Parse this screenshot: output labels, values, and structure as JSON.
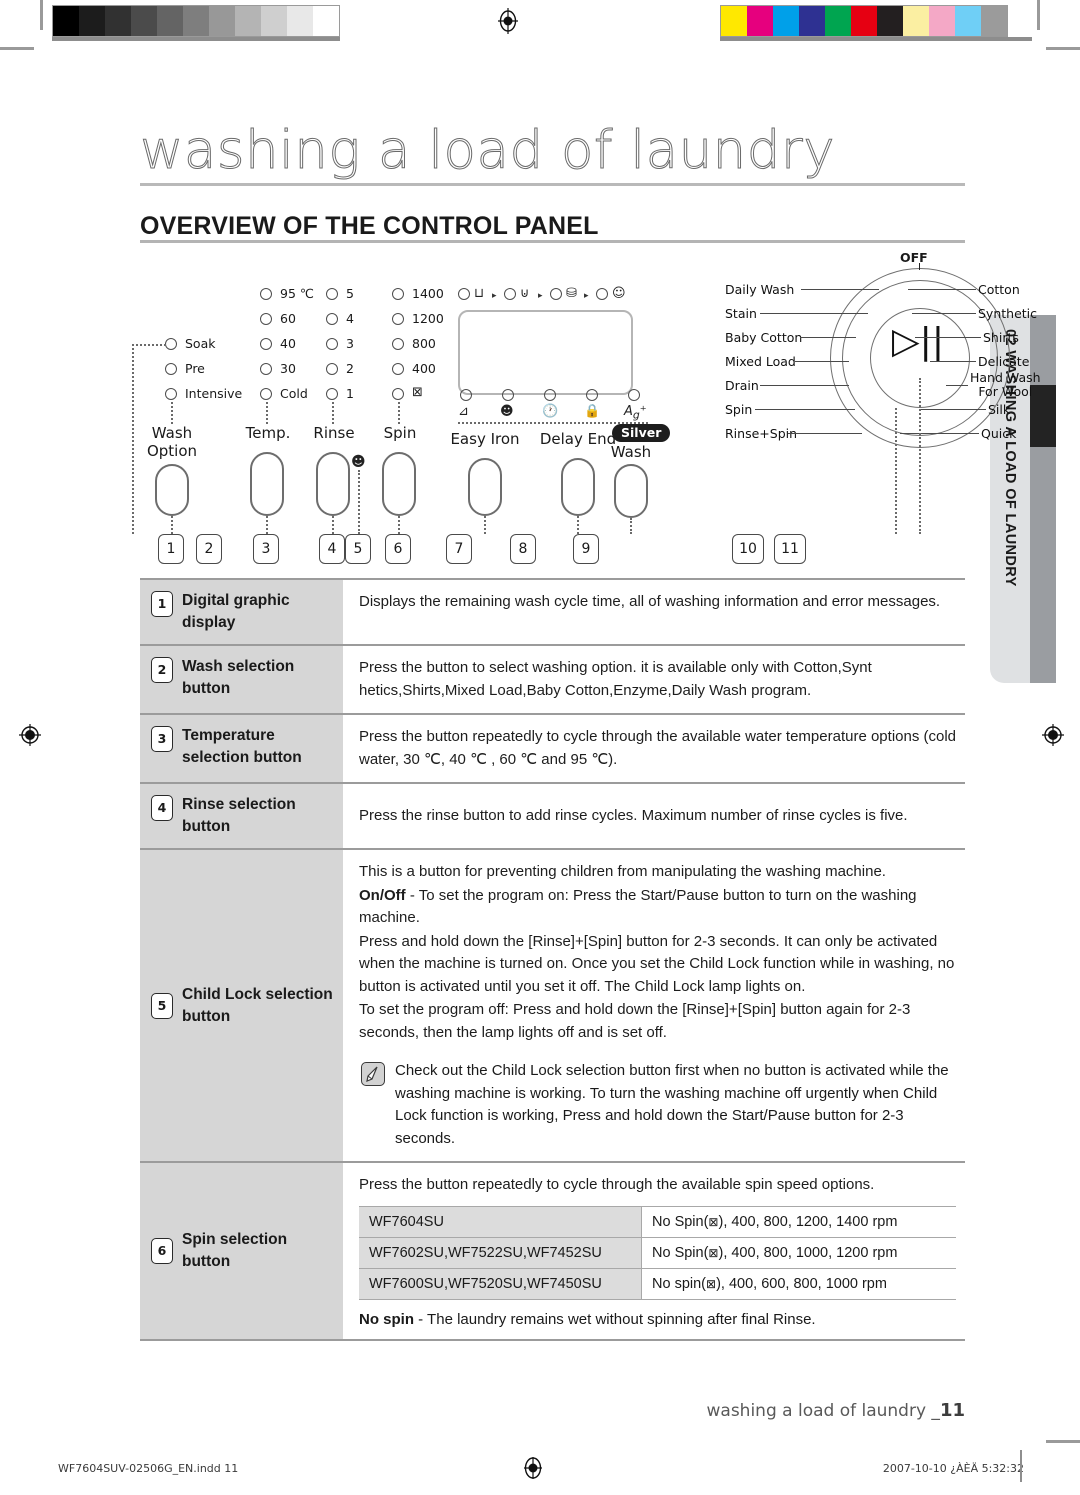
{
  "page": {
    "title": "washing a load of laundry",
    "section_title": "OVERVIEW OF THE CONTROL PANEL",
    "side_tab": "02 WASHING A LOAD OF LAUNDRY",
    "footer_text": "washing a load of laundry _",
    "footer_page": "11",
    "footer_file": "WF7604SUV-02506G_EN.indd   11",
    "footer_date": "2007-10-10   ¿ÀÈÄ 5:32:32"
  },
  "calibration": {
    "gray": [
      "#000000",
      "#1c1c1c",
      "#313131",
      "#4b4b4b",
      "#646464",
      "#7e7e7e",
      "#989898",
      "#b4b4b4",
      "#cfcfcf",
      "#e8e8e8",
      "#ffffff"
    ],
    "color": [
      "#ffe800",
      "#e6007e",
      "#00a0e9",
      "#2e3192",
      "#00a550",
      "#e60012",
      "#231f20",
      "#fbefa2",
      "#f4a8c6",
      "#6fcff6",
      "#9b9b9b"
    ]
  },
  "panel": {
    "columns": [
      {
        "head": "Wash\nOption",
        "leds": [
          "Soak",
          "Pre",
          "Intensive"
        ]
      },
      {
        "head": "Temp.",
        "leds": [
          "95 ℃",
          "60",
          "40",
          "30",
          "Cold"
        ]
      },
      {
        "head": "Rinse",
        "leds": [
          "5",
          "4",
          "3",
          "2",
          "1"
        ]
      },
      {
        "head": "Spin",
        "leds": [
          "1400",
          "1200",
          "800",
          "400",
          "no-spin-icon"
        ]
      }
    ],
    "progress_icons": [
      "wash-icon",
      "rinse-icon",
      "spin-icon",
      "end-icon"
    ],
    "status_icons": [
      "easy-iron-icon",
      "child-lock-baby-icon",
      "delay-end-clock-icon",
      "lock-icon",
      "silver-ag-icon"
    ],
    "right_buttons": [
      "Easy Iron",
      "Delay End"
    ],
    "silver_badge": "Silver",
    "silver_label": "Wash",
    "callouts": [
      "1",
      "2",
      "3",
      "4",
      "5",
      "6",
      "7",
      "8",
      "9",
      "10",
      "11"
    ]
  },
  "dial": {
    "off_label": "OFF",
    "center_icon": "play-pause-icon",
    "left_programs": [
      "Daily Wash",
      "Stain",
      "Baby Cotton",
      "Mixed Load",
      "Drain",
      "Spin",
      "Rinse+Spin"
    ],
    "right_programs": [
      "Cotton",
      "Synthetic",
      "Shirts",
      "Delicate",
      "Hand Wash\nFor Wool",
      "Silk",
      "Quick"
    ],
    "callouts": [
      "10",
      "11"
    ]
  },
  "table": {
    "rows": [
      {
        "num": "1",
        "label": "Digital graphic display",
        "paragraphs": [
          "Displays the remaining wash cycle time, all of washing information and error messages."
        ]
      },
      {
        "num": "2",
        "label": "Wash selection button",
        "paragraphs": [
          "Press the button to select washing option. it is available only with Cotton,Synt hetics,Shirts,Mixed Load,Baby Cotton,Enzyme,Daily Wash program."
        ]
      },
      {
        "num": "3",
        "label": "Temperature selection button",
        "paragraphs": [
          "Press the button repeatedly to cycle through the available water temperature options (cold water, 30 ℃, 40 ℃ , 60 ℃ and 95 ℃)."
        ]
      },
      {
        "num": "4",
        "label": "Rinse selection button",
        "paragraphs": [
          "Press the rinse button to add rinse cycles. Maximum number of rinse cycles is five."
        ]
      }
    ],
    "child_lock": {
      "num": "5",
      "label": "Child Lock selection button",
      "paragraphs": [
        "This is a button for preventing children from manipulating the washing machine.",
        "On/Off - To set the program on: Press the Start/Pause button to turn on the washing machine.",
        "Press and hold down the [Rinse]+[Spin] button for 2-3 seconds. It can only be activated when the machine is turned on. Once you set the Child Lock function while in washing, no button is activated until you set it off. The Child Lock lamp lights on.",
        "To set the program off: Press and hold down the [Rinse]+[Spin] button again for 2-3 seconds, then the lamp lights off and is set off."
      ],
      "bold_lead": "On/Off",
      "note": "Check out the Child Lock selection button first when no button is activated while the washing machine is working. To turn the washing machine off urgently when Child Lock function is working, Press and hold down the Start/Pause button for 2-3 seconds."
    },
    "spin": {
      "num": "6",
      "label": "Spin selection button",
      "intro": "Press the button repeatedly to cycle through the available spin speed options.",
      "models": [
        {
          "model": "WF7604SU",
          "speeds_prefix": "No Spin(",
          "speeds_suffix": "), 400, 800, 1200, 1400 rpm"
        },
        {
          "model": "WF7602SU,WF7522SU,WF7452SU",
          "speeds_prefix": "No Spin(",
          "speeds_suffix": "), 400, 800, 1000, 1200 rpm"
        },
        {
          "model": "WF7600SU,WF7520SU,WF7450SU",
          "speeds_prefix": "No spin(",
          "speeds_suffix": "), 400, 600, 800, 1000 rpm"
        }
      ],
      "footnote_bold": "No spin",
      "footnote_rest": " - The laundry remains wet without spinning after final Rinse."
    }
  }
}
